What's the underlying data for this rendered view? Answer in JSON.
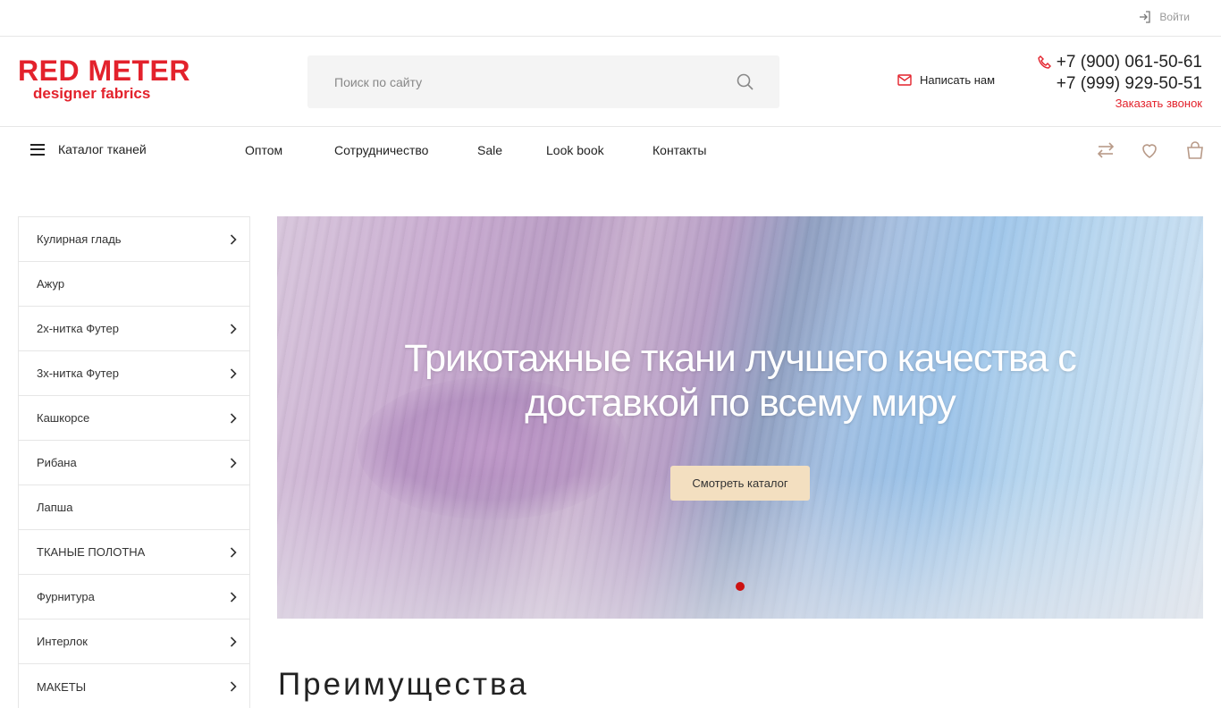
{
  "topbar": {
    "login_label": "Войти"
  },
  "logo": {
    "main": "RED METER",
    "sub": "designer fabrics"
  },
  "search": {
    "placeholder": "Поиск по сайту"
  },
  "contacts": {
    "write_us": "Написать нам",
    "phone1": "+7 (900) 061-50-61",
    "phone2": "+7 (999) 929-50-51",
    "callback": "Заказать звонок"
  },
  "nav": {
    "catalog": "Каталог тканей",
    "links": [
      "Оптом",
      "Сотрудничество",
      "Sale",
      "Look book",
      "Контакты"
    ]
  },
  "sidebar": {
    "items": [
      {
        "label": "Кулирная гладь",
        "has_arrow": true
      },
      {
        "label": "Ажур",
        "has_arrow": false
      },
      {
        "label": "2х-нитка Футер",
        "has_arrow": true
      },
      {
        "label": "3х-нитка Футер",
        "has_arrow": true
      },
      {
        "label": "Кашкорсе",
        "has_arrow": true
      },
      {
        "label": "Рибана",
        "has_arrow": true
      },
      {
        "label": "Лапша",
        "has_arrow": false
      },
      {
        "label": "ТКАНЫЕ ПОЛОТНА",
        "has_arrow": true
      },
      {
        "label": "Фурнитура",
        "has_arrow": true
      },
      {
        "label": "Интерлок",
        "has_arrow": true
      },
      {
        "label": "МАКЕТЫ",
        "has_arrow": true
      }
    ]
  },
  "banner": {
    "title_line1": "Трикотажные ткани лучшего качества с",
    "title_line2": "доставкой по всему миру",
    "button": "Смотреть каталог"
  },
  "section": {
    "title": "Преимущества"
  },
  "colors": {
    "brand": "#e3222c",
    "accent_button": "#f3dfc0",
    "nav_icons": "#b89a88",
    "active_dot": "#cc1111"
  },
  "icons": {
    "login": "login-icon",
    "search": "search-icon",
    "mail": "mail-icon",
    "phone": "phone-icon",
    "compare": "compare-arrows-icon",
    "favorites": "heart-icon",
    "cart": "shopping-bag-icon"
  }
}
